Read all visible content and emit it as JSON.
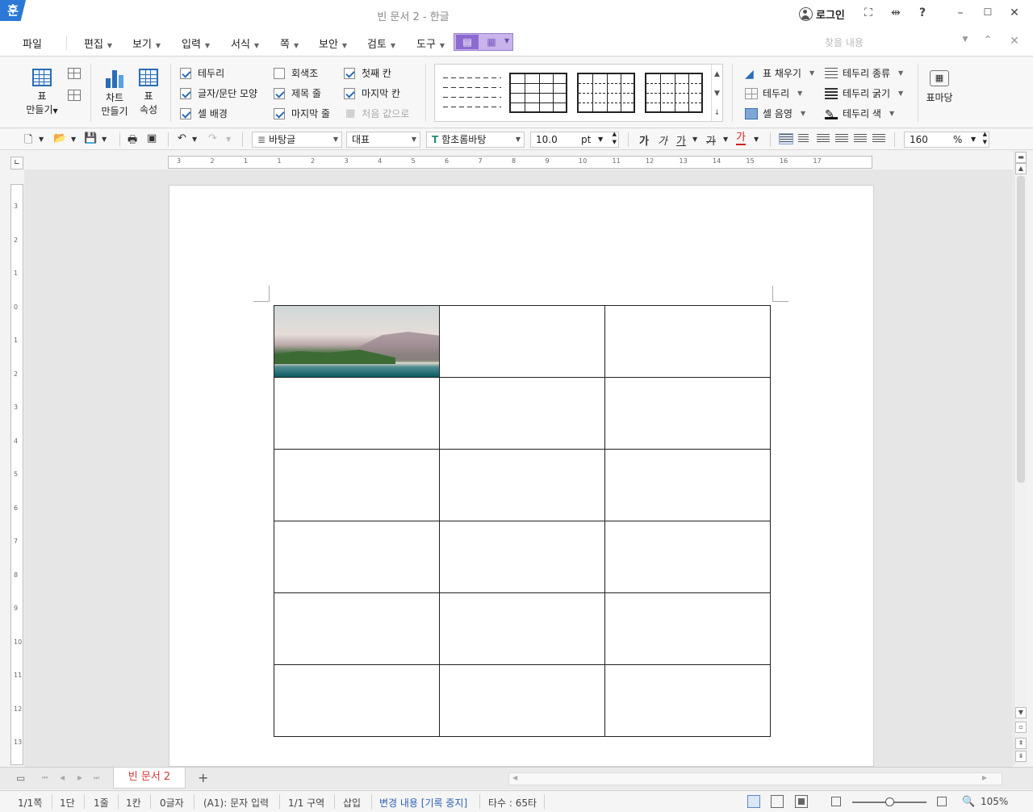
{
  "window": {
    "app_logo": "훈",
    "title": "빈 문서 2 - 한글",
    "login": "로그인",
    "icons": [
      "fullscreen-icon",
      "split-icon",
      "help-icon",
      "minimize-icon",
      "maximize-icon",
      "close-icon"
    ],
    "help_glyph": "?"
  },
  "menu": {
    "file": "파일",
    "items": [
      "편집",
      "보기",
      "입력",
      "서식",
      "쪽",
      "보안",
      "검토",
      "도구"
    ],
    "search_placeholder": "찾을 내용"
  },
  "ribbon": {
    "table": {
      "label1": "표",
      "label2": "만들기"
    },
    "chart": {
      "label1": "차트",
      "label2": "만들기"
    },
    "props": {
      "label1": "표",
      "label2": "속성"
    },
    "checks": [
      {
        "label": "테두리",
        "checked": true
      },
      {
        "label": "글자/문단 모양",
        "checked": true
      },
      {
        "label": "셀 배경",
        "checked": true
      },
      {
        "label": "회색조",
        "checked": false
      },
      {
        "label": "제목 줄",
        "checked": true
      },
      {
        "label": "마지막 줄",
        "checked": true
      },
      {
        "label": "첫째 칸",
        "checked": true
      },
      {
        "label": "마지막 칸",
        "checked": true
      }
    ],
    "reset": "처음 값으로",
    "fill": "표 채우기",
    "border": "테두리",
    "shade": "셀 음영",
    "border_type": "테두리 종류",
    "border_width": "테두리 굵기",
    "border_color": "테두리 색",
    "table_ground": "표마당"
  },
  "format": {
    "para_style": "바탕글",
    "lang": "대표",
    "font": "함초롬바탕",
    "size": "10.0",
    "unit": "pt",
    "bold": "가",
    "italic": "가",
    "underline": "가",
    "strike": "가",
    "color": "가",
    "line_spacing": "160",
    "percent": "%"
  },
  "ruler": {
    "h_ticks": [
      "3",
      "2",
      "1",
      "1",
      "2",
      "3",
      "4",
      "5",
      "6",
      "7",
      "8",
      "9",
      "10",
      "11",
      "12",
      "13",
      "14",
      "15",
      "16",
      "17"
    ],
    "v_ticks": [
      "3",
      "2",
      "1",
      "0",
      "1",
      "2",
      "3",
      "4",
      "5",
      "6",
      "7",
      "8",
      "9",
      "10",
      "11",
      "12",
      "13"
    ]
  },
  "tabs": {
    "doc": "빈 문서 2",
    "add": "+"
  },
  "status": {
    "page": "1/1쪽",
    "col": "1단",
    "line": "1줄",
    "cell": "1칸",
    "chars": "0글자",
    "mode": "(A1): 문자 입력",
    "section": "1/1 구역",
    "insert": "삽입",
    "track": "변경 내용 [기록 중지]",
    "typing": "타수 : 65타",
    "zoom": "105%"
  },
  "colors": {
    "accent": "#2a6db5",
    "context_tab": "#8c6ad0",
    "tab_text": "#d23c3c"
  }
}
